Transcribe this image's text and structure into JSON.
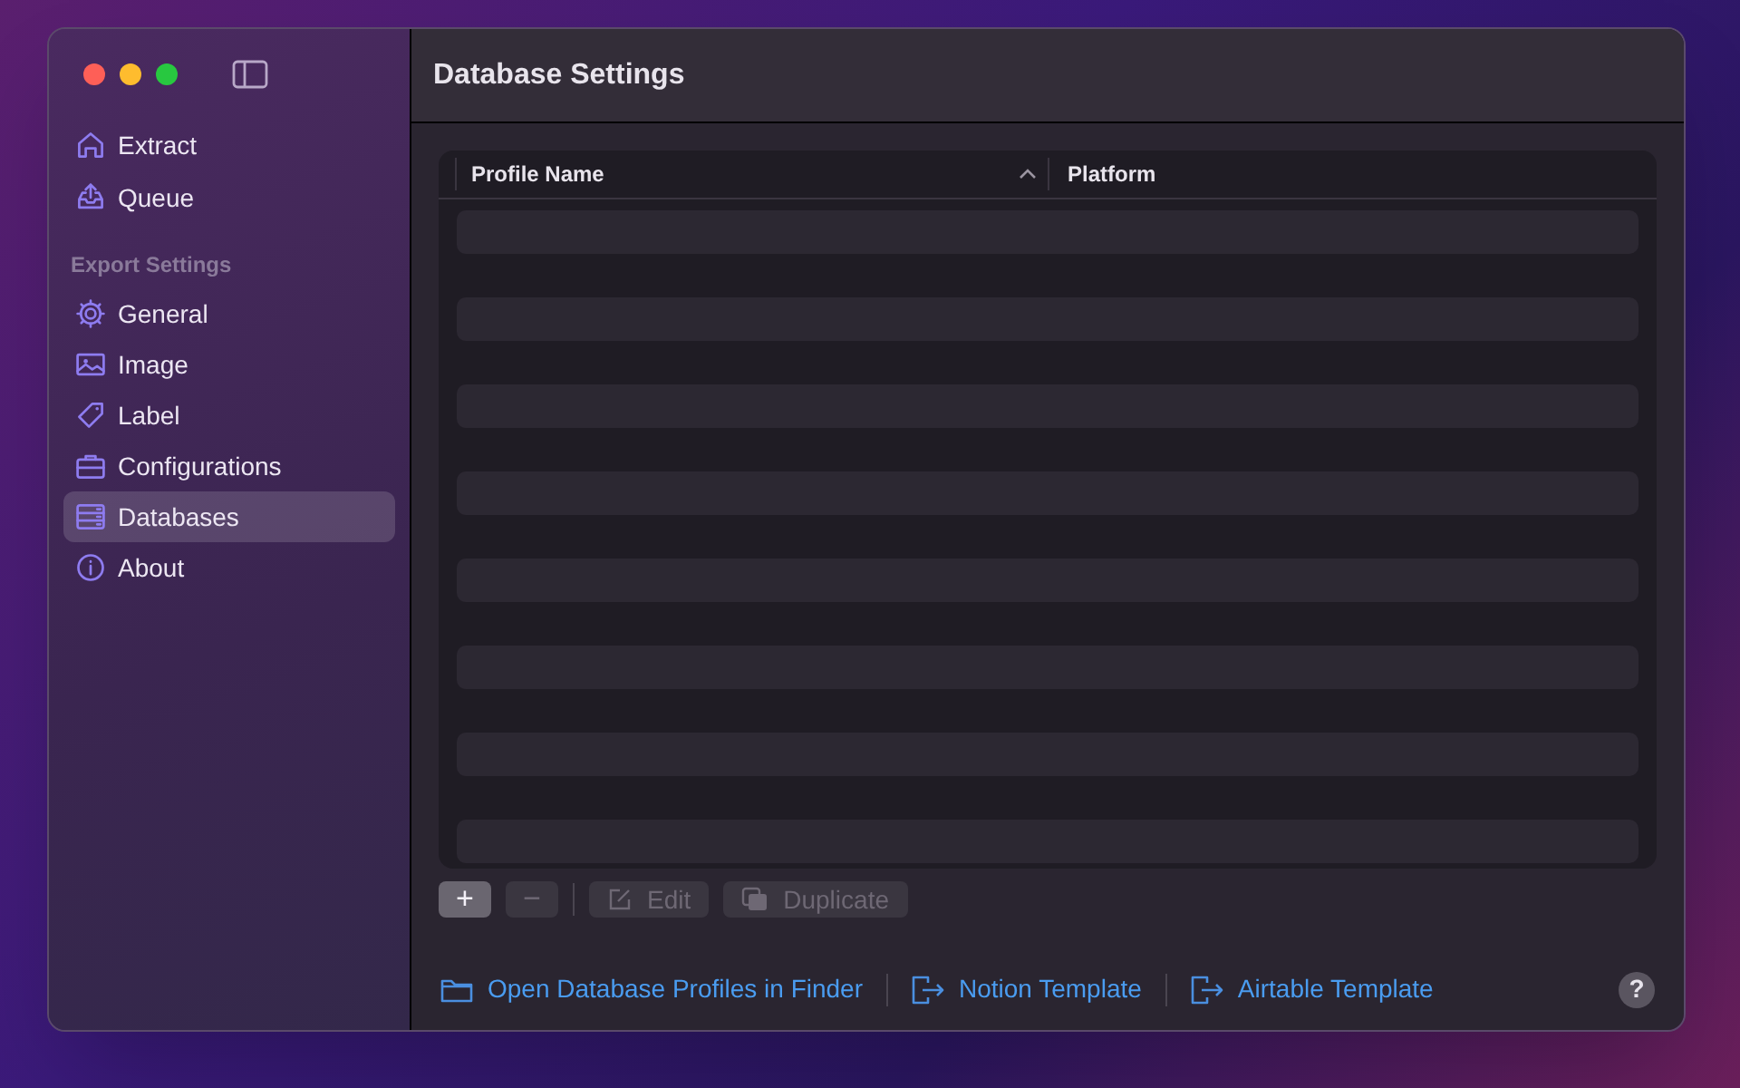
{
  "window": {
    "title": "Database Settings"
  },
  "sidebar": {
    "items": [
      {
        "label": "Extract",
        "kind": "home",
        "selected": false
      },
      {
        "label": "Queue",
        "kind": "tray",
        "selected": false
      }
    ],
    "section_title": "Export Settings",
    "section_items": [
      {
        "label": "General",
        "kind": "gear",
        "selected": false
      },
      {
        "label": "Image",
        "kind": "photo",
        "selected": false
      },
      {
        "label": "Label",
        "kind": "tag",
        "selected": false
      },
      {
        "label": "Configurations",
        "kind": "briefcase",
        "selected": false
      },
      {
        "label": "Databases",
        "kind": "database",
        "selected": true
      },
      {
        "label": "About",
        "kind": "info",
        "selected": false
      }
    ]
  },
  "table": {
    "columns": [
      {
        "label": "Profile Name",
        "sorted": true
      },
      {
        "label": "Platform",
        "sorted": false
      }
    ]
  },
  "toolbar": [
    {
      "label": "+",
      "kind": "add",
      "disabled": false
    },
    {
      "label": "−",
      "kind": "remove",
      "disabled": true
    },
    {
      "label": "Edit",
      "kind": "edit",
      "disabled": true
    },
    {
      "label": "Duplicate",
      "kind": "duplicate",
      "disabled": true
    }
  ],
  "links": [
    {
      "label": "Open Database Profiles in Finder",
      "kind": "folder"
    },
    {
      "label": "Notion Template",
      "kind": "exit"
    },
    {
      "label": "Airtable Template",
      "kind": "exit"
    }
  ],
  "help_button": "?"
}
